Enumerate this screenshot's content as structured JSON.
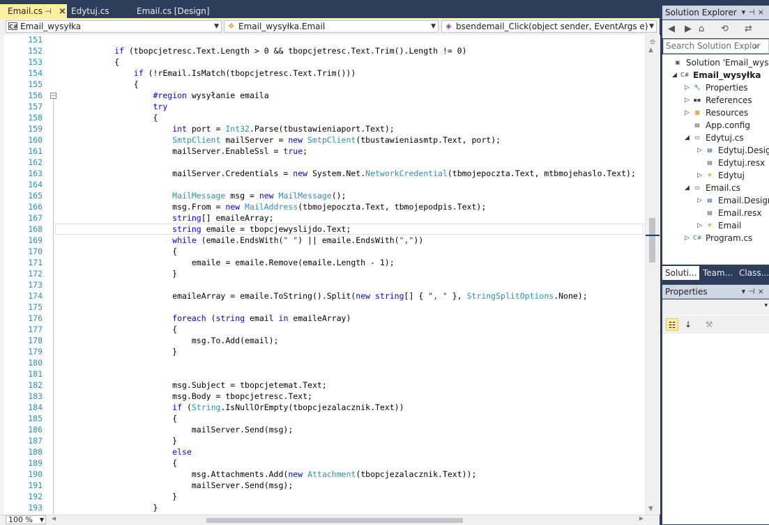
{
  "tabs": [
    {
      "label": "Email.cs",
      "active": true
    },
    {
      "label": "Edytuj.cs",
      "active": false
    },
    {
      "label": "Email.cs [Design]",
      "active": false
    }
  ],
  "navbar": {
    "project": "Email_wysyłka",
    "class": "Email_wysyłka.Email",
    "member": "bsendemail_Click(object sender, EventArgs e)"
  },
  "code_lines": [
    {
      "n": "151",
      "html": ""
    },
    {
      "n": "152",
      "html": "            <span class='kw'>if</span> (tbopcjetresc.Text.Length &gt; 0 &amp;&amp; tbopcjetresc.Text.Trim().Length != 0)"
    },
    {
      "n": "153",
      "html": "            {"
    },
    {
      "n": "154",
      "html": "                <span class='kw'>if</span> (!rEmail.IsMatch(tbopcjetresc.Text.Trim()))"
    },
    {
      "n": "155",
      "html": "                {"
    },
    {
      "n": "156",
      "html": "                    <span class='pp'>#region</span> wysyłanie emaila"
    },
    {
      "n": "157",
      "html": "                    <span class='kw'>try</span>"
    },
    {
      "n": "158",
      "html": "                    {"
    },
    {
      "n": "159",
      "html": "                        <span class='kw'>int</span> port = <span class='ty'>Int32</span>.Parse(tbustawieniaport.Text);"
    },
    {
      "n": "160",
      "html": "                        <span class='ty'>SmtpClient</span> mailServer = <span class='kw'>new</span> <span class='ty'>SmtpClient</span>(tbustawieniasmtp.Text, port);"
    },
    {
      "n": "161",
      "html": "                        mailServer.EnableSsl = <span class='kw'>true</span>;"
    },
    {
      "n": "162",
      "html": ""
    },
    {
      "n": "163",
      "html": "                        mailServer.Credentials = <span class='kw'>new</span> System.Net.<span class='ty'>NetworkCredential</span>(tbmojepoczta.Text, mtbmojehaslo.Text);"
    },
    {
      "n": "164",
      "html": ""
    },
    {
      "n": "165",
      "html": "                        <span class='ty'>MailMessage</span> msg = <span class='kw'>new</span> <span class='ty'>MailMessage</span>();"
    },
    {
      "n": "166",
      "html": "                        msg.From = <span class='kw'>new</span> <span class='ty'>MailAddress</span>(tbmojepoczta.Text, tbmojepodpis.Text);"
    },
    {
      "n": "167",
      "html": "                        <span class='kw'>string</span>[] emaileArray;"
    },
    {
      "n": "168",
      "html": "                        <span class='kw'>string</span> emaile = tbopcjewyslijdo.Text;"
    },
    {
      "n": "169",
      "html": "                        <span class='kw'>while</span> (emaile.EndsWith(<span class='st'>\" \"</span>) || emaile.EndsWith(<span class='st'>\",\"</span>))"
    },
    {
      "n": "170",
      "html": "                        {"
    },
    {
      "n": "171",
      "html": "                            emaile = emaile.Remove(emaile.Length - 1);"
    },
    {
      "n": "172",
      "html": "                        }"
    },
    {
      "n": "173",
      "html": ""
    },
    {
      "n": "174",
      "html": "                        emaileArray = emaile.ToString().Split(<span class='kw'>new</span> <span class='kw'>string</span>[] { <span class='st'>\", \"</span> }, <span class='ty'>StringSplitOptions</span>.None);"
    },
    {
      "n": "175",
      "html": ""
    },
    {
      "n": "176",
      "html": "                        <span class='kw'>foreach</span> (<span class='kw'>string</span> email <span class='kw'>in</span> emaileArray)"
    },
    {
      "n": "177",
      "html": "                        {"
    },
    {
      "n": "178",
      "html": "                            msg.To.Add(email);"
    },
    {
      "n": "179",
      "html": "                        }"
    },
    {
      "n": "180",
      "html": ""
    },
    {
      "n": "181",
      "html": ""
    },
    {
      "n": "182",
      "html": "                        msg.Subject = tbopcjetemat.Text;"
    },
    {
      "n": "183",
      "html": "                        msg.Body = tbopcjetresc.Text;"
    },
    {
      "n": "184",
      "html": "                        <span class='kw'>if</span> (<span class='ty'>String</span>.IsNullOrEmpty(tbopcjezalacznik.Text))"
    },
    {
      "n": "185",
      "html": "                        {"
    },
    {
      "n": "186",
      "html": "                            mailServer.Send(msg);"
    },
    {
      "n": "187",
      "html": "                        }"
    },
    {
      "n": "188",
      "html": "                        <span class='kw'>else</span>"
    },
    {
      "n": "189",
      "html": "                        {"
    },
    {
      "n": "190",
      "html": "                            msg.Attachments.Add(<span class='kw'>new</span> <span class='ty'>Attachment</span>(tbopcjezalacznik.Text));"
    },
    {
      "n": "191",
      "html": "                            mailServer.Send(msg);"
    },
    {
      "n": "192",
      "html": "                        }"
    },
    {
      "n": "193",
      "html": "                    }"
    }
  ],
  "current_line": "168",
  "zoom": "100 %",
  "solution_explorer": {
    "title": "Solution Explorer",
    "search_placeholder": "Search Solution Explor",
    "items": [
      {
        "label": "Solution 'Email_wysyłk",
        "level": 0,
        "exp": "",
        "icon": "solution-icon",
        "bold": false
      },
      {
        "label": "Email_wysyłka",
        "level": 1,
        "exp": "◢",
        "icon": "csharp-project-icon",
        "bold": true
      },
      {
        "label": "Properties",
        "level": 2,
        "exp": "▷",
        "icon": "wrench-icon",
        "bold": false
      },
      {
        "label": "References",
        "level": 2,
        "exp": "▷",
        "icon": "references-icon",
        "bold": false
      },
      {
        "label": "Resources",
        "level": 2,
        "exp": "▷",
        "icon": "folder-icon",
        "bold": false
      },
      {
        "label": "App.config",
        "level": 2,
        "exp": "",
        "icon": "config-icon",
        "bold": false
      },
      {
        "label": "Edytuj.cs",
        "level": 2,
        "exp": "◢",
        "icon": "form-icon",
        "bold": false
      },
      {
        "label": "Edytuj.Design",
        "level": 3,
        "exp": "▷",
        "icon": "cs-file-icon",
        "bold": false
      },
      {
        "label": "Edytuj.resx",
        "level": 3,
        "exp": "",
        "icon": "resx-icon",
        "bold": false
      },
      {
        "label": "Edytuj",
        "level": 3,
        "exp": "▷",
        "icon": "class-icon",
        "bold": false
      },
      {
        "label": "Email.cs",
        "level": 2,
        "exp": "◢",
        "icon": "form-icon",
        "bold": false
      },
      {
        "label": "Email.Design",
        "level": 3,
        "exp": "▷",
        "icon": "cs-file-icon",
        "bold": false
      },
      {
        "label": "Email.resx",
        "level": 3,
        "exp": "",
        "icon": "resx-icon",
        "bold": false
      },
      {
        "label": "Email",
        "level": 3,
        "exp": "▷",
        "icon": "class-icon",
        "bold": false
      },
      {
        "label": "Program.cs",
        "level": 2,
        "exp": "▷",
        "icon": "csharp-file-icon",
        "bold": false
      }
    ],
    "bottom_tabs": [
      "Soluti...",
      "Team...",
      "Class..."
    ]
  },
  "properties": {
    "title": "Properties"
  },
  "colors": {
    "accent": "#fff0a0",
    "chrome": "#2d3e5c",
    "keyword": "#0000ff",
    "type": "#2b91af",
    "string": "#a31515"
  }
}
